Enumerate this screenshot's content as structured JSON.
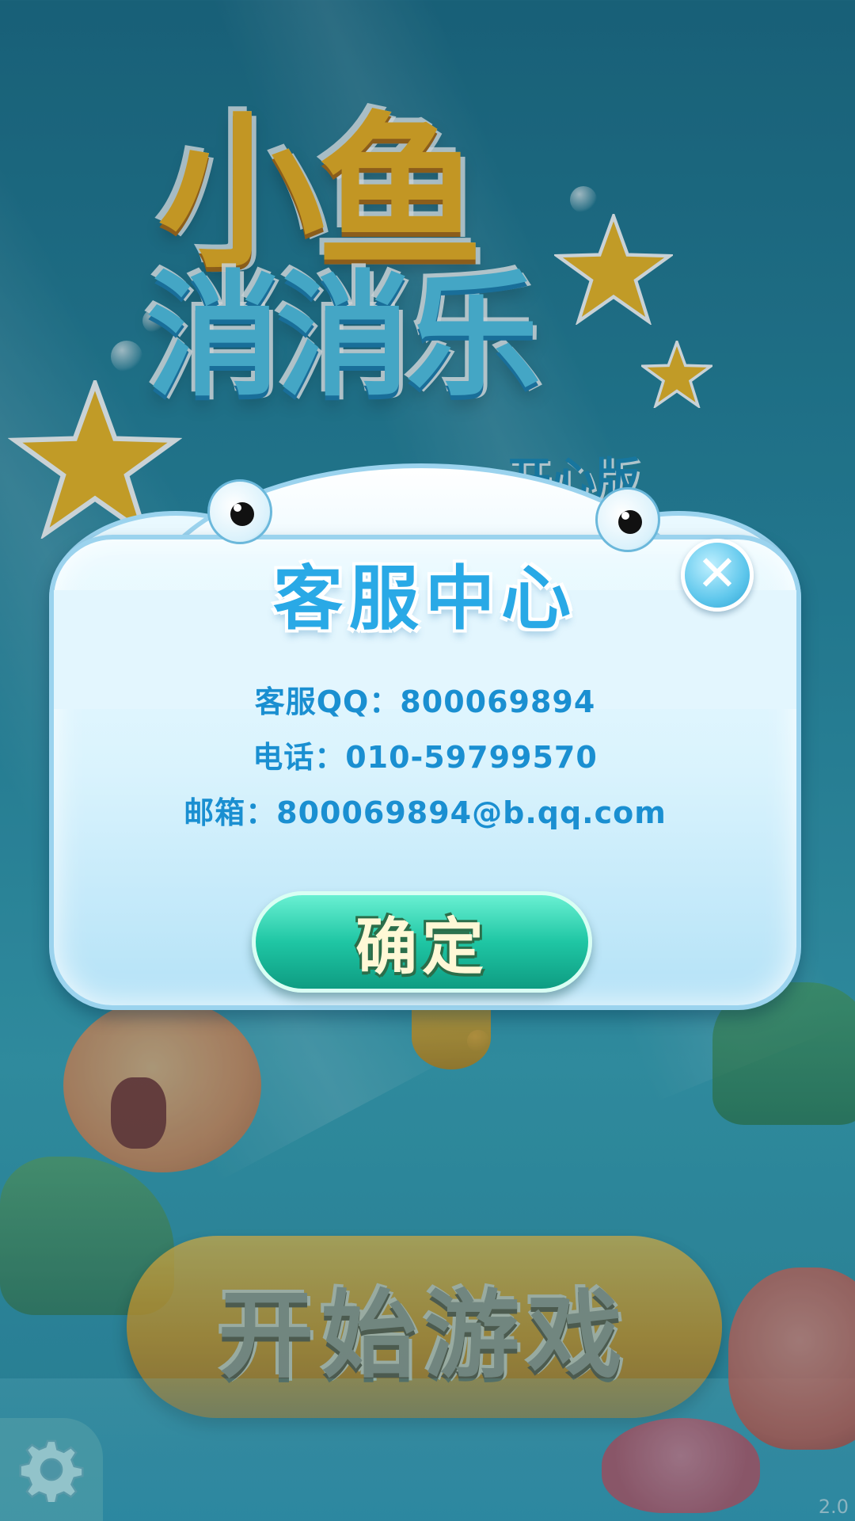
{
  "game": {
    "logo_line1": "小鱼",
    "logo_line2": "消消乐",
    "logo_edition": "开心版"
  },
  "dialog": {
    "title": "客服中心",
    "qq": "客服QQ：800069894",
    "phone": "电话：010-59799570",
    "email": "邮箱：800069894@b.qq.com",
    "confirm_label": "确定",
    "close_icon": "close-icon"
  },
  "main_menu": {
    "start_label": "开始游戏",
    "settings_icon": "gear-icon"
  },
  "version": "2.0",
  "colors": {
    "dialog_text": "#1a8fd1",
    "title": "#29a9e6",
    "confirm_button": "#1fc6a4",
    "start_button": "#e89d1a"
  }
}
